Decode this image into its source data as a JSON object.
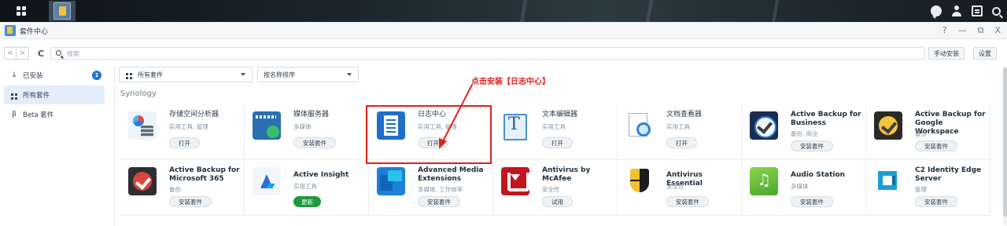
{
  "taskbar": {
    "main_menu_icon": "grid-icon",
    "right_icons": [
      "chat-icon",
      "user-icon",
      "widget-icon",
      "search-icon"
    ]
  },
  "window": {
    "title": "套件中心",
    "controls": [
      "?",
      "—",
      "⧉",
      "X"
    ]
  },
  "toolbar": {
    "search_placeholder": "搜索",
    "manual_install": "手动安装",
    "settings": "设置"
  },
  "sidebar": {
    "items": [
      {
        "label": "已安装",
        "icon": "↓",
        "badge": "1"
      },
      {
        "label": "所有套件",
        "icon": "grid"
      },
      {
        "label": "Beta 套件",
        "icon": "β"
      }
    ]
  },
  "filters": {
    "category": "所有套件",
    "sort": "按名称排序"
  },
  "section": "Synology",
  "packages": [
    {
      "name": "存储空间分析器",
      "category": "实用工具, 管理",
      "action": "打开",
      "icon": "storage-analyzer-icon"
    },
    {
      "name": "媒体服务器",
      "category": "多媒体",
      "action": "安装套件",
      "icon": "media-server-icon"
    },
    {
      "name": "日志中心",
      "category": "实用工具, 管理",
      "action": "打开",
      "icon": "log-center-icon"
    },
    {
      "name": "文本编辑器",
      "category": "实用工具",
      "action": "打开",
      "icon": "text-editor-icon"
    },
    {
      "name": "文档查看器",
      "category": "实用工具",
      "action": "打开",
      "icon": "document-viewer-icon"
    },
    {
      "name": "Active Backup for Business",
      "category": "备份, 商业",
      "action": "安装套件",
      "icon": "active-backup-business-icon"
    },
    {
      "name": "Active Backup for Google Workspace",
      "category": "备份",
      "action": "安装套件",
      "icon": "active-backup-google-icon"
    },
    {
      "name": "Active Backup for Microsoft 365",
      "category": "备份",
      "action": "安装套件",
      "icon": "active-backup-m365-icon"
    },
    {
      "name": "Active Insight",
      "category": "实用工具",
      "action": "更新",
      "icon": "active-insight-icon"
    },
    {
      "name": "Advanced Media Extensions",
      "category": "多媒体, 工作效率",
      "action": "安装套件",
      "icon": "advanced-media-extensions-icon"
    },
    {
      "name": "Antivirus by McAfee",
      "category": "安全性",
      "action": "试用",
      "icon": "mcafee-icon"
    },
    {
      "name": "Antivirus Essential",
      "category": "安全性",
      "action": "安装套件",
      "icon": "antivirus-essential-icon"
    },
    {
      "name": "Audio Station",
      "category": "多媒体",
      "action": "安装套件",
      "icon": "audio-station-icon"
    },
    {
      "name": "C2 Identity Edge Server",
      "category": "管理",
      "action": "安装套件",
      "icon": "c2-identity-icon"
    }
  ],
  "annotation": {
    "text": "点击安装【日志中心】",
    "color": "#e2211b"
  },
  "colors": {
    "accent": "#1e75d3",
    "update_green": "#1f9a3c",
    "annotation_red": "#e2211b"
  }
}
